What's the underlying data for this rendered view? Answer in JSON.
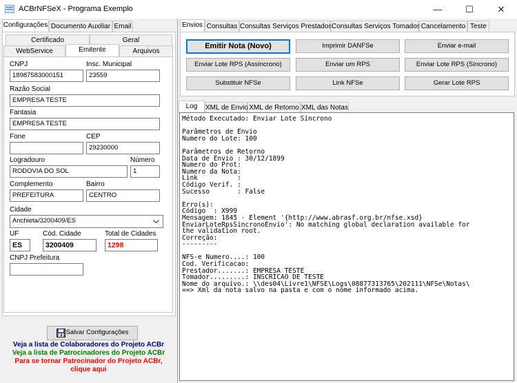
{
  "window": {
    "title": "ACBrNFSeX - Programa Exemplo",
    "minimize": "—",
    "maximize": "☐",
    "close": "✕"
  },
  "left": {
    "tabs": [
      "Configurações",
      "Documento Auxiliar",
      "Email"
    ],
    "subtabs_row1": [
      "Certificado",
      "Geral"
    ],
    "subtabs_row2": [
      "WebService",
      "Emitente",
      "Arquivos"
    ],
    "fields": {
      "cnpj_label": "CNPJ",
      "cnpj": "18987583000151",
      "im_label": "Insc. Municipal",
      "im": "23559",
      "razao_label": "Razão Social",
      "razao": "EMPRESA TESTE",
      "fantasia_label": "Fantasia",
      "fantasia": "EMPRESA TESTE",
      "fone_label": "Fone",
      "fone": "",
      "cep_label": "CEP",
      "cep": "29230000",
      "logradouro_label": "Logradouro",
      "logradouro": "RODOVIA DO SOL",
      "numero_label": "Número",
      "numero": "1",
      "complemento_label": "Complemento",
      "complemento": "PREFEITURA",
      "bairro_label": "Bairro",
      "bairro": "CENTRO",
      "cidade_label": "Cidade",
      "cidade": "Anchieta/3200409/ES",
      "uf_label": "UF",
      "uf": "ES",
      "codcidade_label": "Cód. Cidade",
      "codcidade": "3200409",
      "totalcidades_label": "Total de Cidades",
      "totalcidades": "1298",
      "cnpjpref_label": "CNPJ Prefeitura",
      "cnpjpref": ""
    },
    "save_button": "Salvar Configurações",
    "links": [
      {
        "text": "Veja a lista de Colaboradores do Projeto ACBr",
        "color": "#000080"
      },
      {
        "text": "Veja a lista de Patrocinadores do Projeto ACBr",
        "color": "#008000"
      },
      {
        "text": "Para se tornar Patrocinador do Projeto ACBr,",
        "color": "#ff0000"
      },
      {
        "text": "clique aqui",
        "color": "#ff0000"
      }
    ]
  },
  "right": {
    "tabs": [
      "Envios",
      "Consultas",
      "Consultas Serviços Prestados",
      "Consultas Serviços Tomados",
      "Cancelamento",
      "Teste"
    ],
    "buttons": [
      "Emitir Nota (Novo)",
      "Imprimir DANFSe",
      "Enviar e-mail",
      "Enviar Lote RPS (Assíncrono)",
      "Enviar um RPS",
      "Enviar Lote RPS (Síncrono)",
      "Substituir NFSe",
      "Link NFSe",
      "Gerar Lote RPS"
    ],
    "log_tabs": [
      "Log",
      "XML de Envio",
      "XML de Retorno",
      "XML das Notas"
    ],
    "log_lines": [
      "Método Executado: Enviar Lote Síncrono",
      "",
      "Parâmetros de Envio",
      "Numero do Lote: 100",
      "",
      "Parâmetros de Retorno",
      "Data de Envio : 30/12/1899",
      "Numero do Prot:",
      "Numero da Nota:",
      "Link          :",
      "Código Verif. :",
      "Sucesso       : False",
      "",
      "Erro(s):",
      "Código  : X999",
      "Mensagem: 1845 - Element '{http://www.abrasf.org.br/nfse.xsd}",
      "EnviarLoteRpsSincronoEnvio': No matching global declaration available for",
      "the validation root.",
      "Correção:",
      "---------",
      "",
      "NFS-e Numero....: 100",
      "Cod. Verificacao:",
      "Prestador.......: EMPRESA TESTE",
      "Tomador.........: INSCRICAO DE TESTE",
      "Nome do arquivo.: \\\\des04\\Livre1\\NFSE\\Logs\\08877313765\\202111\\NFSe\\Notas\\",
      "==> Xml da nota salvo na pasta e com o nome informado acima."
    ]
  }
}
